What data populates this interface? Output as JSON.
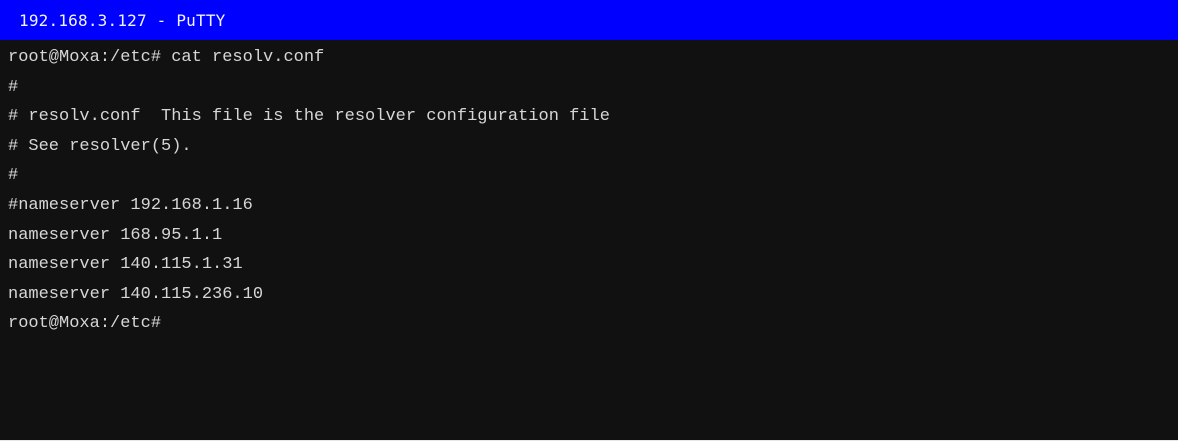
{
  "window": {
    "title": "192.168.3.127 - PuTTY"
  },
  "terminal": {
    "lines": [
      "root@Moxa:/etc# cat resolv.conf",
      "#",
      "# resolv.conf  This file is the resolver configuration file",
      "# See resolver(5).",
      "#",
      "#nameserver 192.168.1.16",
      "nameserver 168.95.1.1",
      "nameserver 140.115.1.31",
      "nameserver 140.115.236.10",
      "root@Moxa:/etc#"
    ]
  },
  "colors": {
    "titlebar_bg": "#0000ff",
    "titlebar_text": "#f2f2ff",
    "terminal_bg": "#111111",
    "terminal_text": "#d6d6d6"
  }
}
